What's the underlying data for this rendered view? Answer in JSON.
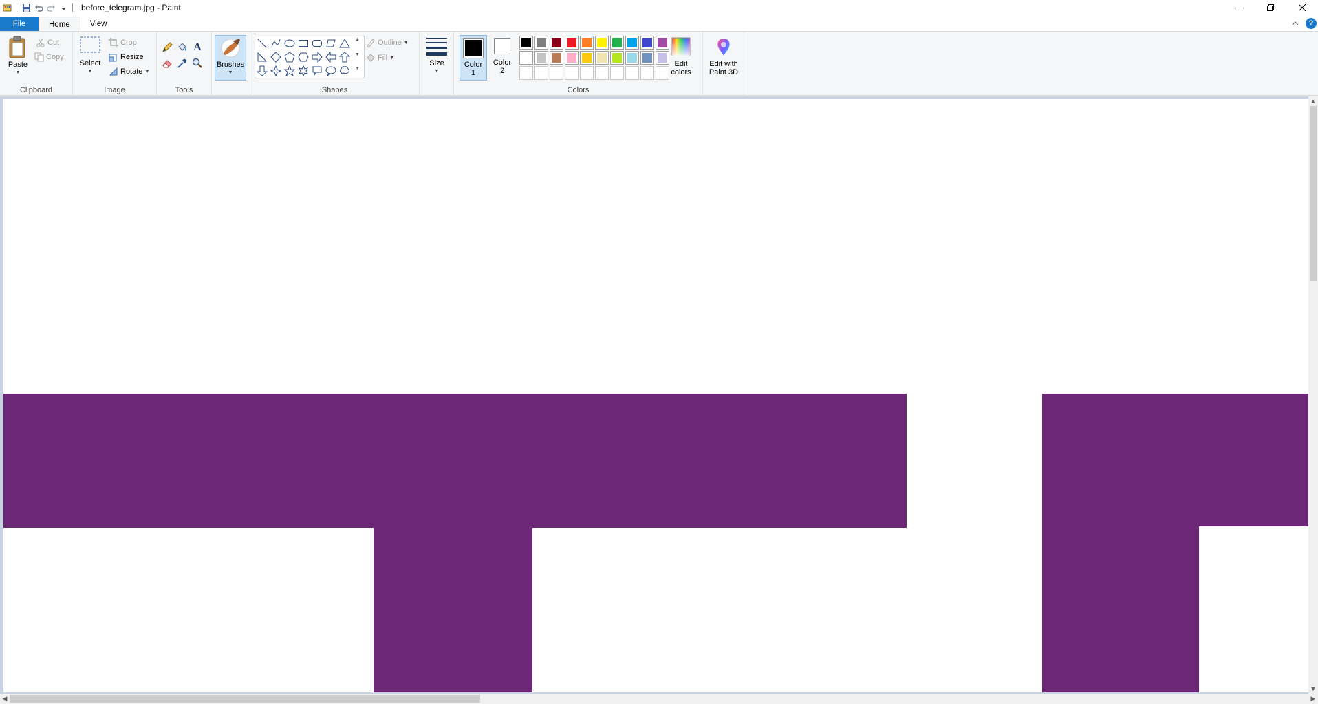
{
  "window": {
    "title": "before_telegram.jpg - Paint"
  },
  "tabs": {
    "file": "File",
    "home": "Home",
    "view": "View"
  },
  "clipboard": {
    "group_label": "Clipboard",
    "paste": "Paste",
    "cut": "Cut",
    "copy": "Copy"
  },
  "image": {
    "group_label": "Image",
    "select": "Select",
    "crop": "Crop",
    "resize": "Resize",
    "rotate": "Rotate"
  },
  "tools": {
    "group_label": "Tools"
  },
  "brushes": {
    "label": "Brushes"
  },
  "shapes": {
    "group_label": "Shapes",
    "outline": "Outline",
    "fill": "Fill"
  },
  "size": {
    "label": "Size"
  },
  "colors": {
    "group_label": "Colors",
    "color1_label": "Color",
    "color1_num": "1",
    "color2_label": "Color",
    "color2_num": "2",
    "color1_value": "#000000",
    "color2_value": "#ffffff",
    "edit_colors_1": "Edit",
    "edit_colors_2": "colors",
    "palette_row1": [
      "#000000",
      "#7f7f7f",
      "#880015",
      "#ed1c24",
      "#ff7f27",
      "#fff200",
      "#22b14c",
      "#00a2e8",
      "#3f48cc",
      "#a349a4"
    ],
    "palette_row2": [
      "#ffffff",
      "#c3c3c3",
      "#b97a57",
      "#ffaec9",
      "#ffc90e",
      "#efe4b0",
      "#b5e61d",
      "#99d9ea",
      "#7092be",
      "#c8bfe7"
    ]
  },
  "paint3d": {
    "line1": "Edit with",
    "line2": "Paint 3D"
  },
  "canvas": {
    "shape_color": "#6c2876"
  }
}
